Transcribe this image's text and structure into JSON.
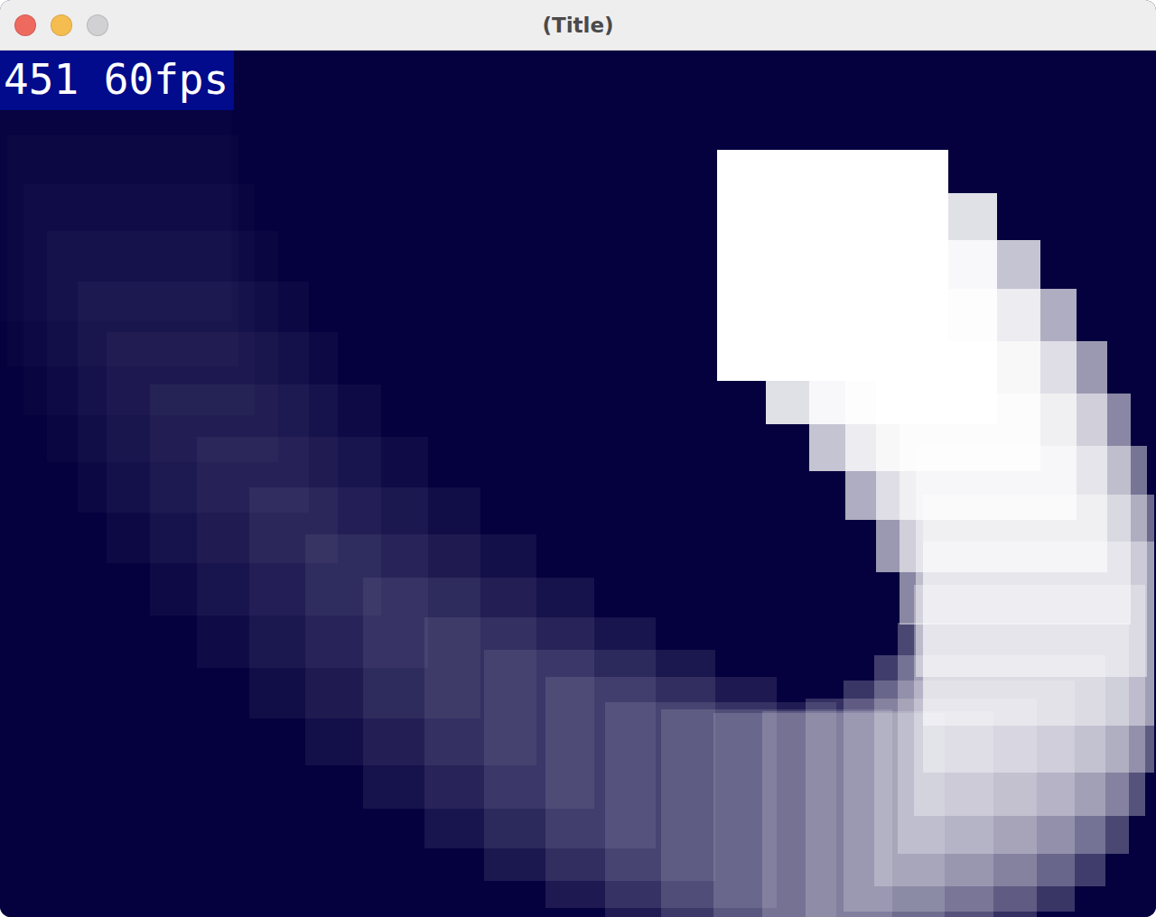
{
  "window": {
    "title": "(Title)"
  },
  "controls": [
    {
      "kind": "close",
      "color": "#ee6a5f"
    },
    {
      "kind": "minimize",
      "color": "#f5bd4f"
    },
    {
      "kind": "zoom",
      "color": "#d1d0d2"
    }
  ],
  "overlay": {
    "text": "451 60fps"
  },
  "trail": [
    {
      "level": 1
    },
    {
      "level": 0.88
    },
    {
      "level": 0.77
    },
    {
      "level": 0.68
    },
    {
      "level": 0.6
    },
    {
      "level": 0.53
    },
    {
      "level": 0.46
    },
    {
      "level": 0.41
    },
    {
      "level": 0.36
    },
    {
      "level": 0.32
    },
    {
      "level": 0.28
    },
    {
      "level": 0.24
    },
    {
      "level": 0.21
    },
    {
      "level": 0.19
    },
    {
      "level": 0.17
    },
    {
      "level": 0.15
    },
    {
      "level": 0.13
    },
    {
      "level": 0.11
    },
    {
      "level": 0.1
    },
    {
      "level": 0.09
    },
    {
      "level": 0.08
    },
    {
      "level": 0.07
    },
    {
      "level": 0.06
    },
    {
      "level": 0.05
    },
    {
      "level": 0.045
    },
    {
      "level": 0.04
    },
    {
      "level": 0.035
    },
    {
      "level": 0.03
    },
    {
      "level": 0.025
    },
    {
      "level": 0.02
    },
    {
      "level": 0.02
    },
    {
      "level": 0.015
    }
  ]
}
